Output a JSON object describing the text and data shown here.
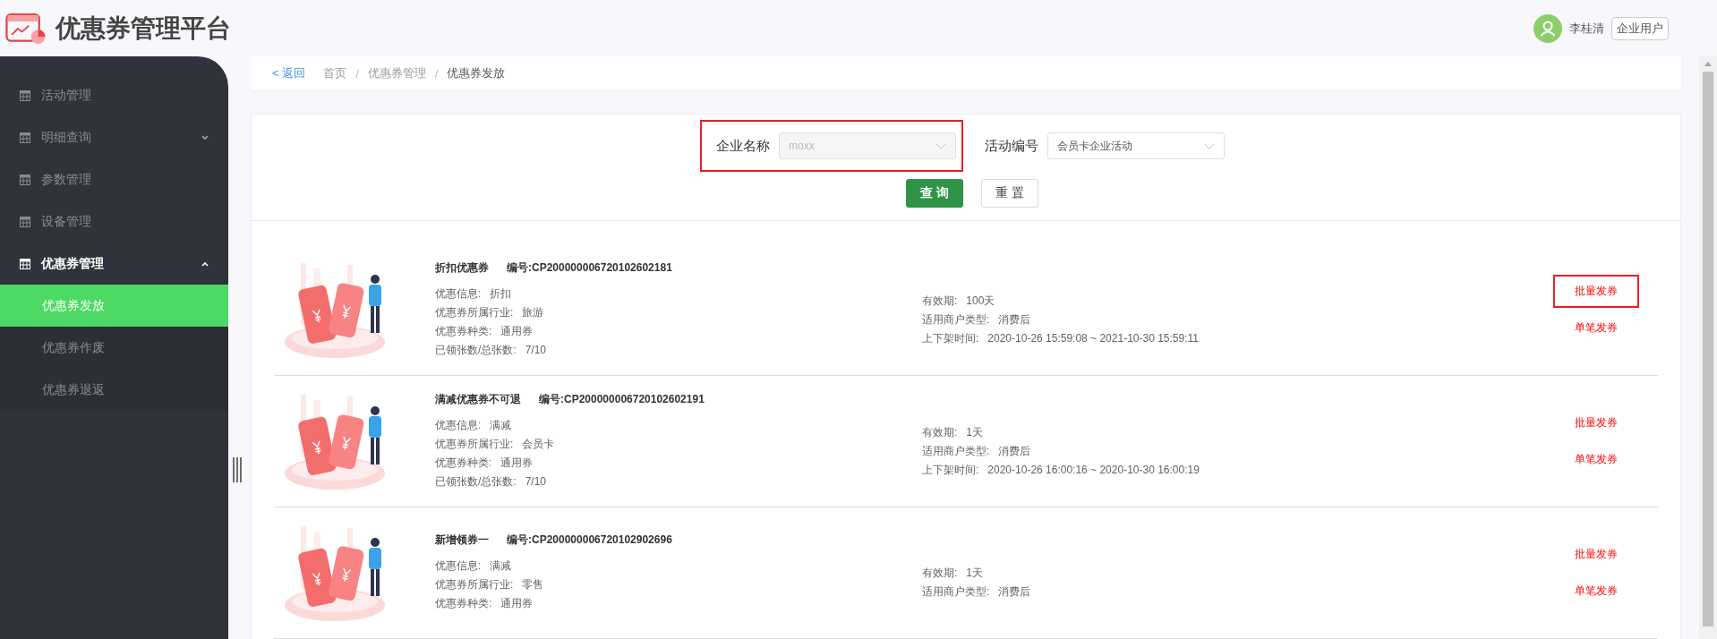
{
  "app": {
    "title": "优惠券管理平台"
  },
  "user": {
    "name": "李桂清",
    "role": "企业用户"
  },
  "sidebar": {
    "items": [
      {
        "label": "活动管理",
        "kind": "link",
        "selected": false
      },
      {
        "label": "明细查询",
        "kind": "group",
        "selected": false,
        "expanded": false
      },
      {
        "label": "参数管理",
        "kind": "link",
        "selected": false
      },
      {
        "label": "设备管理",
        "kind": "link",
        "selected": false
      },
      {
        "label": "优惠券管理",
        "kind": "group",
        "selected": true,
        "expanded": true,
        "children": [
          {
            "label": "优惠券发放",
            "selected": true
          },
          {
            "label": "优惠券作废",
            "selected": false
          },
          {
            "label": "优惠券退返",
            "selected": false
          }
        ]
      }
    ]
  },
  "breadcrumb": {
    "back": "< 返回",
    "separator": "/",
    "items": [
      "首页",
      "优惠券管理",
      "优惠券发放"
    ]
  },
  "filters": [
    {
      "label": "企业名称",
      "value": "moxx",
      "disabled": true,
      "highlighted": true
    },
    {
      "label": "活动编号",
      "value": "会员卡企业活动",
      "disabled": false,
      "highlighted": false
    }
  ],
  "buttons": [
    {
      "label": "查 询",
      "kind": "primary"
    },
    {
      "label": "重 置",
      "kind": "default"
    }
  ],
  "coupons": [
    {
      "name": "折扣优惠券",
      "code": "编号:CP200000006720102602181",
      "details": [
        {
          "label": "优惠信息:",
          "value": "折扣"
        },
        {
          "label": "优惠券所属行业:",
          "value": "旅游"
        },
        {
          "label": "优惠券种类:",
          "value": "通用券"
        },
        {
          "label": "已领张数/总张数:",
          "value": "7/10"
        }
      ],
      "terms": [
        {
          "label": "有效期:",
          "value": "100天"
        },
        {
          "label": "适用商户类型:",
          "value": "消费后"
        },
        {
          "label": "上下架时间:",
          "value": "2020-10-26 15:59:08 ~ 2021-10-30 15:59:11"
        }
      ],
      "actions": [
        {
          "label": "批量发券",
          "highlighted": true
        },
        {
          "label": "单笔发券",
          "highlighted": false
        }
      ]
    },
    {
      "name": "满减优惠券不可退",
      "code": "编号:CP200000006720102602191",
      "details": [
        {
          "label": "优惠信息:",
          "value": "满减"
        },
        {
          "label": "优惠券所属行业:",
          "value": "会员卡"
        },
        {
          "label": "优惠券种类:",
          "value": "通用券"
        },
        {
          "label": "已领张数/总张数:",
          "value": "7/10"
        }
      ],
      "terms": [
        {
          "label": "有效期:",
          "value": "1天"
        },
        {
          "label": "适用商户类型:",
          "value": "消费后"
        },
        {
          "label": "上下架时间:",
          "value": "2020-10-26 16:00:16 ~ 2020-10-30 16:00:19"
        }
      ],
      "actions": [
        {
          "label": "批量发券",
          "highlighted": false
        },
        {
          "label": "单笔发券",
          "highlighted": false
        }
      ]
    },
    {
      "name": "新增领券一",
      "code": "编号:CP200000006720102902696",
      "details": [
        {
          "label": "优惠信息:",
          "value": "满减"
        },
        {
          "label": "优惠券所属行业:",
          "value": "零售"
        },
        {
          "label": "优惠券种类:",
          "value": "通用券"
        }
      ],
      "terms": [
        {
          "label": "有效期:",
          "value": "1天"
        },
        {
          "label": "适用商户类型:",
          "value": "消费后"
        }
      ],
      "actions": [
        {
          "label": "批量发券",
          "highlighted": false
        },
        {
          "label": "单笔发券",
          "highlighted": false
        }
      ]
    }
  ]
}
